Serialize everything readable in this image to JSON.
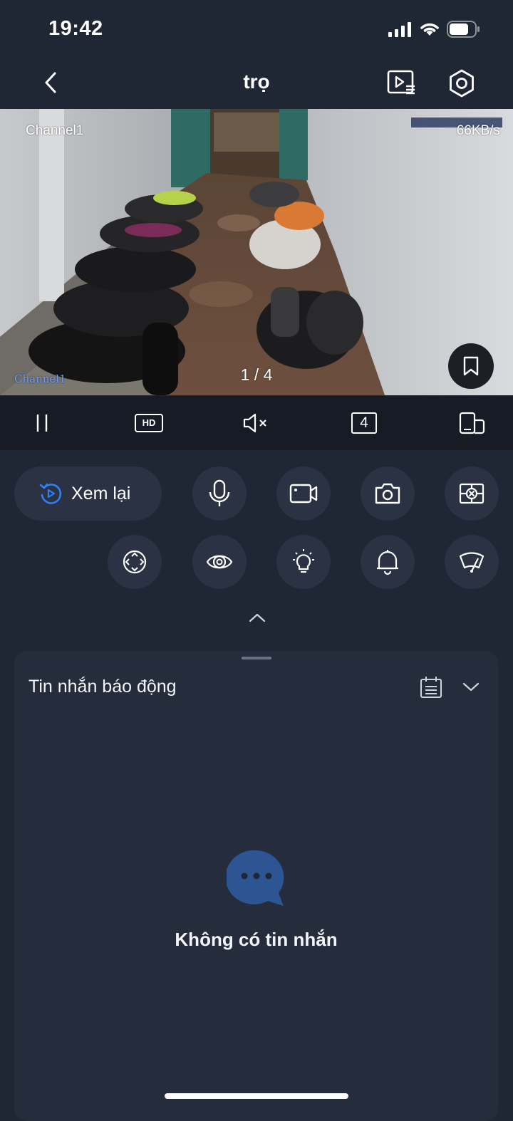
{
  "status_bar": {
    "time": "19:42"
  },
  "nav": {
    "title": "trọ",
    "back_icon": "chevron-left-icon",
    "playback_list_icon": "playlist-icon",
    "settings_icon": "hexagon-settings-icon"
  },
  "video": {
    "channel_label": "Channel1",
    "bitrate": "66KB/s",
    "osd_channel": "Channel1",
    "page_indicator": "1 / 4"
  },
  "controls": {
    "quality": "HD",
    "split_count": "4"
  },
  "actions": {
    "replay_label": "Xem lại",
    "accent": "#2f7ff5"
  },
  "alarm": {
    "title": "Tin nhắn báo động",
    "empty_text": "Không có tin nhắn",
    "empty_icon_color": "#2d5594"
  }
}
